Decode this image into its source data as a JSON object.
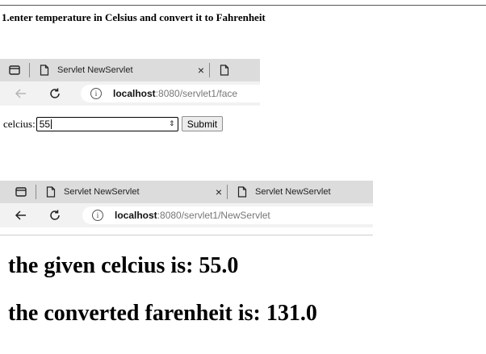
{
  "heading": "1.enter temperature in Celsius and convert it to Fahrenheit",
  "browser1": {
    "tab_title": "Servlet NewServlet",
    "close": "×",
    "host": "localhost",
    "path": ":8080/servlet1/face"
  },
  "form": {
    "label": "celcius:",
    "value": "55",
    "spinner": "⇕",
    "submit_label": "Submit"
  },
  "browser2": {
    "tab_title": "Servlet NewServlet",
    "close": "×",
    "tab2_title": "Servlet NewServlet",
    "host": "localhost",
    "path": ":8080/servlet1/NewServlet"
  },
  "result": {
    "celcius_line": "the given celcius is: 55.0",
    "farenheit_line": "the converted farenheit is: 131.0"
  }
}
